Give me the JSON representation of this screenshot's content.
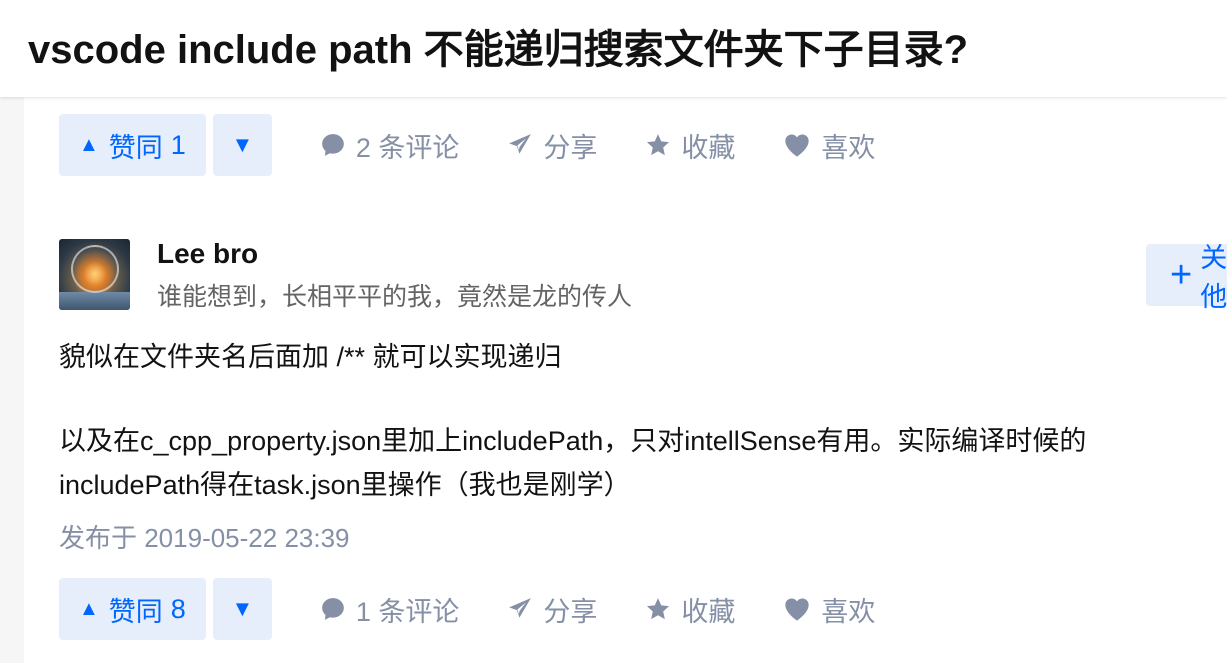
{
  "question": {
    "title": "vscode include path 不能递归搜索文件夹下子目录?"
  },
  "top_actions": {
    "upvote_label": "赞同",
    "upvote_count": "1",
    "upvote_arrow": "▲",
    "downvote_arrow": "▼",
    "comments_label": "2 条评论",
    "share_label": "分享",
    "favorite_label": "收藏",
    "like_label": "喜欢"
  },
  "answer": {
    "author": {
      "name": "Lee bro",
      "bio": "谁能想到，长相平平的我，竟然是龙的传人"
    },
    "follow": {
      "plus": "+",
      "label": "关注他"
    },
    "paragraphs": [
      "貌似在文件夹名后面加 /** 就可以实现递归",
      "以及在c_cpp_property.json里加上includePath，只对intellSense有用。实际编译时候的includePath得在task.json里操作（我也是刚学）"
    ],
    "published": "发布于 2019-05-22 23:39",
    "actions": {
      "upvote_label": "赞同",
      "upvote_count": "8",
      "upvote_arrow": "▲",
      "downvote_arrow": "▼",
      "comments_label": "1 条评论",
      "share_label": "分享",
      "favorite_label": "收藏",
      "like_label": "喜欢"
    }
  },
  "colors": {
    "accent": "#0066ff",
    "accent_bg": "#e7eefb",
    "muted": "#8590a6",
    "text": "#121212"
  },
  "icons": [
    "comment-icon",
    "share-icon",
    "star-icon",
    "heart-icon",
    "avatar"
  ]
}
